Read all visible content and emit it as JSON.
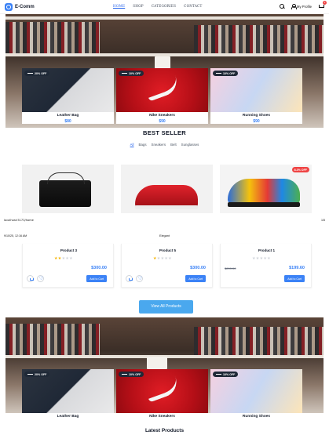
{
  "header": {
    "brand": "E-Comm",
    "nav": [
      "HOME",
      "SHOP",
      "CATEGORIES",
      "CONTACT"
    ],
    "active_nav": "HOME",
    "profile_label": "My Profile",
    "cart_count": "2"
  },
  "hero": {
    "cards": [
      {
        "name": "Leather Bag",
        "price": "$80",
        "badge": "20% OFF"
      },
      {
        "name": "Nike Sneakers",
        "price": "$90",
        "badge": "10% OFF"
      },
      {
        "name": "Running Shoes",
        "price": "$90",
        "badge": "10% OFF"
      }
    ]
  },
  "best_seller": {
    "title": "BEST SELLER",
    "tabs": [
      "All",
      "Bags",
      "Sneakers",
      "Belt",
      "Sunglasses"
    ],
    "active_tab": "All",
    "discount_badge": "8.2% OFF"
  },
  "print": {
    "url": "localhost:5173/home",
    "page": "1/5",
    "datetime": "9/10/25, 12:16 AM",
    "title": "Elegant"
  },
  "products": [
    {
      "name": "Product 3",
      "rating": 2,
      "price": "$300.00",
      "old_price": "",
      "add_label": "Add to Cart"
    },
    {
      "name": "Product 5",
      "rating": 1,
      "price": "$300.00",
      "old_price": "",
      "add_label": "Add to Cart"
    },
    {
      "name": "Product 1",
      "rating": 0,
      "price": "$199.60",
      "old_price": "$209.00",
      "add_label": "Add to Cart"
    }
  ],
  "view_all_label": "View All Products",
  "hero2": {
    "cards": [
      {
        "name": "Leather Bag",
        "badge": "20% OFF"
      },
      {
        "name": "Nike Sneakers",
        "badge": "10% OFF"
      },
      {
        "name": "Running Shoes",
        "badge": "10% OFF"
      }
    ]
  },
  "latest_title": "Latest Products"
}
